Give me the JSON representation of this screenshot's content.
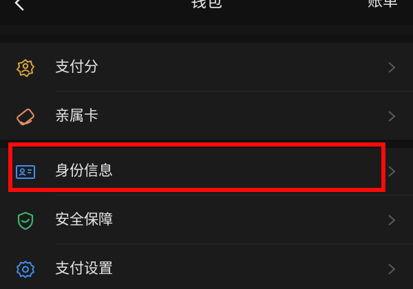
{
  "header": {
    "title": "钱包",
    "bill_label": "账单"
  },
  "menu": {
    "items": [
      {
        "label": "支付分",
        "icon": "payment-score-icon",
        "color": "#d9a441"
      },
      {
        "label": "亲属卡",
        "icon": "family-card-icon",
        "color": "#e08f62"
      },
      {
        "label": "身份信息",
        "icon": "id-card-icon",
        "color": "#3f8ef0"
      },
      {
        "label": "安全保障",
        "icon": "shield-icon",
        "color": "#3ab46c"
      },
      {
        "label": "支付设置",
        "icon": "gear-icon",
        "color": "#3f8ef0"
      }
    ]
  },
  "colors": {
    "background": "#111111",
    "list_background": "#1b1b1b",
    "highlight": "#ff0a0a"
  }
}
